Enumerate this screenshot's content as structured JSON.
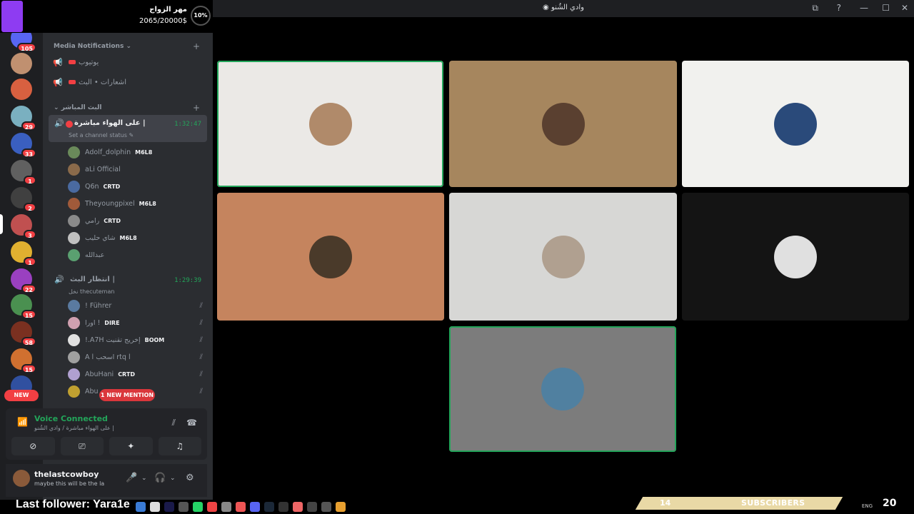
{
  "donation": {
    "title": "مهر الزواج",
    "amount": "2065/20000$",
    "percent": "10%"
  },
  "window": {
    "title": "وادي الشُنو"
  },
  "rail": {
    "servers": [
      {
        "color": "#5865f2",
        "badge": "105"
      },
      {
        "color": "#c09070",
        "badge": ""
      },
      {
        "color": "#d86040",
        "badge": ""
      },
      {
        "color": "#7ab0c0",
        "badge": "29"
      },
      {
        "color": "#3a5fc0",
        "badge": "33"
      },
      {
        "color": "#606060",
        "badge": "1"
      },
      {
        "color": "#404040",
        "badge": "2"
      },
      {
        "color": "#c05050",
        "badge": "3"
      },
      {
        "color": "#e0b030",
        "badge": "1"
      },
      {
        "color": "#9a40c0",
        "badge": "22"
      },
      {
        "color": "#4a9050",
        "badge": "15"
      },
      {
        "color": "#7a3020",
        "badge": "58"
      },
      {
        "color": "#d07030",
        "badge": "15"
      },
      {
        "color": "#3050a0",
        "badge": ""
      }
    ],
    "new_label": "NEW"
  },
  "sidebar": {
    "cat_media": "Media Notifications",
    "media_channels": [
      "يوتيوب",
      "اشعارات • البث"
    ],
    "cat_live": "البث المباشر",
    "active_channel": {
      "name": "على الهواء مباشرة |",
      "time": "1:32:47",
      "status": "Set a channel status"
    },
    "active_users": [
      {
        "name": "Adolf_dolphin",
        "tag": "M6L8",
        "color": "#6a8a5a"
      },
      {
        "name": "aLi Official",
        "tag": "",
        "color": "#8a6a4a"
      },
      {
        "name": "Q6n",
        "tag": "CRTD",
        "color": "#4a6aa0"
      },
      {
        "name": "Theyoungpixel",
        "tag": "M6L8",
        "color": "#a05a3a"
      },
      {
        "name": "رامي",
        "tag": "CRTD",
        "color": "#8a8a8a"
      },
      {
        "name": "شاي حليب",
        "tag": "M6L8",
        "color": "#c0c0c0"
      },
      {
        "name": "عبدالله",
        "tag": "",
        "color": "#5aa070"
      }
    ],
    "waiting_channel": {
      "name": "انتظار البث |",
      "time": "1:29:39",
      "status": "نخل thecuteman"
    },
    "waiting_users": [
      {
        "name": "! Führer",
        "tag": "",
        "color": "#5a7aa0"
      },
      {
        "name": "اورا !",
        "tag": "DIRE",
        "color": "#d0a0b0"
      },
      {
        "name": "!.A7H إخريج تقنيت",
        "tag": "BOOM",
        "color": "#e0e0e0"
      },
      {
        "name": "A l اسحب rtq l",
        "tag": "",
        "color": "#a0a0a0"
      },
      {
        "name": "AbuHani",
        "tag": "CRTD",
        "color": "#b0a0d0"
      },
      {
        "name": "Abu",
        "tag": "",
        "color": "#c0a030"
      }
    ],
    "mention": "1 NEW MENTION"
  },
  "voice": {
    "title": "Voice Connected",
    "sub": "على الهواء مباشرة / وادي الشُنو |"
  },
  "user": {
    "name": "thelastcowboy",
    "status": "maybe this will be the la"
  },
  "tiles": [
    {
      "bg": "#ebe9e6",
      "avatar": "#b08a6a",
      "speaking": true
    },
    {
      "bg": "#a6865e",
      "avatar": "#5a4030",
      "speaking": false
    },
    {
      "bg": "#f1f1ee",
      "avatar": "#2a4a7a",
      "speaking": false
    },
    {
      "bg": "#c5845e",
      "avatar": "#4a3a2a",
      "speaking": false
    },
    {
      "bg": "#d7d7d5",
      "avatar": "#b0a090",
      "speaking": false
    },
    {
      "bg": "#141414",
      "avatar": "#e0e0e0",
      "speaking": false
    },
    {
      "bg": "#7c7c7c",
      "avatar": "#5080a0",
      "speaking": true
    }
  ],
  "stream": {
    "last_follower": "Last follower: Yara1e",
    "subs_count": "14",
    "subs_label": "SUBSCRIBERS",
    "tray_lang": "ENG",
    "tray_num": "20"
  }
}
